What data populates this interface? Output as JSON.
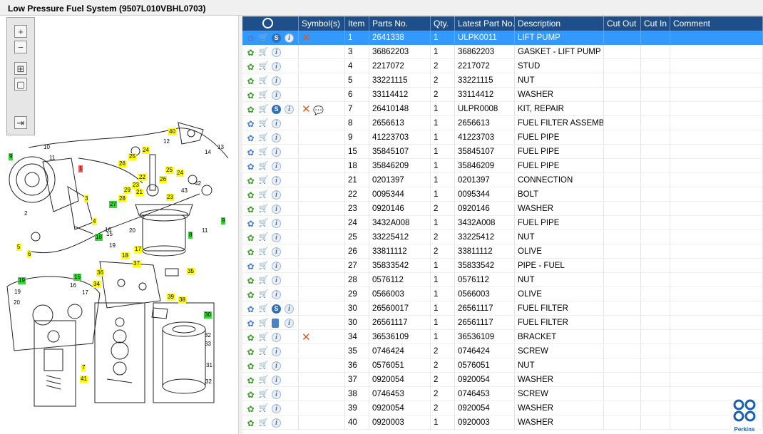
{
  "window": {
    "title": "Low Pressure Fuel System (9507L010VBHL0703)"
  },
  "diagram": {
    "toolbar": [
      {
        "name": "zoom-in-button",
        "glyph": "+"
      },
      {
        "name": "zoom-out-button",
        "glyph": "−"
      },
      {
        "name": "fit-all-button",
        "glyph": "⊞"
      },
      {
        "name": "zoom-window-button",
        "glyph": "▢"
      },
      {
        "name": "export-button",
        "glyph": "⇥"
      }
    ],
    "callouts": [
      {
        "t": "40",
        "c": "y"
      },
      {
        "t": "12",
        "c": "p"
      },
      {
        "t": "14",
        "c": "p"
      },
      {
        "t": "13",
        "c": "p"
      },
      {
        "t": "10",
        "c": "p"
      },
      {
        "t": "11",
        "c": "p"
      },
      {
        "t": "9",
        "c": "g"
      },
      {
        "t": "1",
        "c": "r"
      },
      {
        "t": "25",
        "c": "y"
      },
      {
        "t": "24",
        "c": "y"
      },
      {
        "t": "26",
        "c": "y"
      },
      {
        "t": "22",
        "c": "y"
      },
      {
        "t": "25",
        "c": "y"
      },
      {
        "t": "24",
        "c": "y"
      },
      {
        "t": "23",
        "c": "y"
      },
      {
        "t": "26",
        "c": "y"
      },
      {
        "t": "29",
        "c": "y"
      },
      {
        "t": "21",
        "c": "y"
      },
      {
        "t": "43",
        "c": "p"
      },
      {
        "t": "42",
        "c": "p"
      },
      {
        "t": "28",
        "c": "y"
      },
      {
        "t": "27",
        "c": "g"
      },
      {
        "t": "23",
        "c": "y"
      },
      {
        "t": "3",
        "c": "y"
      },
      {
        "t": "2",
        "c": "p"
      },
      {
        "t": "4",
        "c": "y"
      },
      {
        "t": "16",
        "c": "p"
      },
      {
        "t": "15",
        "c": "p"
      },
      {
        "t": "20",
        "c": "p"
      },
      {
        "t": "18",
        "c": "g"
      },
      {
        "t": "17",
        "c": "y"
      },
      {
        "t": "11",
        "c": "p"
      },
      {
        "t": "9",
        "c": "g"
      },
      {
        "t": "8",
        "c": "g"
      },
      {
        "t": "5",
        "c": "y"
      },
      {
        "t": "6",
        "c": "y"
      },
      {
        "t": "19",
        "c": "p"
      },
      {
        "t": "18",
        "c": "y"
      },
      {
        "t": "37",
        "c": "y"
      },
      {
        "t": "35",
        "c": "y"
      },
      {
        "t": "15",
        "c": "g"
      },
      {
        "t": "36",
        "c": "y"
      },
      {
        "t": "34",
        "c": "y"
      },
      {
        "t": "19",
        "c": "g"
      },
      {
        "t": "19",
        "c": "p"
      },
      {
        "t": "20",
        "c": "p"
      },
      {
        "t": "16",
        "c": "p"
      },
      {
        "t": "17",
        "c": "p"
      },
      {
        "t": "39",
        "c": "y"
      },
      {
        "t": "38",
        "c": "y"
      },
      {
        "t": "30",
        "c": "g"
      },
      {
        "t": "32",
        "c": "p"
      },
      {
        "t": "33",
        "c": "p"
      },
      {
        "t": "7",
        "c": "y"
      },
      {
        "t": "41",
        "c": "y"
      },
      {
        "t": "31",
        "c": "p"
      },
      {
        "t": "32",
        "c": "p"
      }
    ]
  },
  "grid": {
    "columns": [
      "",
      "Symbol(s)",
      "Item",
      "Parts No.",
      "Qty.",
      "Latest Part No.",
      "Description",
      "Cut Out",
      "Cut In",
      "Comment"
    ],
    "rows": [
      {
        "icons": [
          "gear-blue",
          "cart",
          "s",
          "i"
        ],
        "sym": "x",
        "item": "1",
        "part": "2641338",
        "qty": "1",
        "latest": "ULPK0011",
        "desc": "LIFT PUMP",
        "selected": true
      },
      {
        "icons": [
          "gear",
          "cart",
          "i"
        ],
        "sym": "",
        "item": "3",
        "part": "36862203",
        "qty": "1",
        "latest": "36862203",
        "desc": "GASKET - LIFT PUMP"
      },
      {
        "icons": [
          "gear",
          "cart",
          "i"
        ],
        "sym": "",
        "item": "4",
        "part": "2217072",
        "qty": "2",
        "latest": "2217072",
        "desc": "STUD"
      },
      {
        "icons": [
          "gear",
          "cart",
          "i"
        ],
        "sym": "",
        "item": "5",
        "part": "33221115",
        "qty": "2",
        "latest": "33221115",
        "desc": "NUT"
      },
      {
        "icons": [
          "gear",
          "cart",
          "i"
        ],
        "sym": "",
        "item": "6",
        "part": "33114412",
        "qty": "2",
        "latest": "33114412",
        "desc": "WASHER"
      },
      {
        "icons": [
          "gear",
          "cart",
          "s",
          "i"
        ],
        "sym": "x-tip",
        "item": "7",
        "part": "26410148",
        "qty": "1",
        "latest": "ULPR0008",
        "desc": "KIT, REPAIR"
      },
      {
        "icons": [
          "gear-blue",
          "cart",
          "i"
        ],
        "sym": "",
        "item": "8",
        "part": "2656613",
        "qty": "1",
        "latest": "2656613",
        "desc": "FUEL FILTER ASSEMBLY"
      },
      {
        "icons": [
          "gear-blue",
          "cart",
          "i"
        ],
        "sym": "",
        "item": "9",
        "part": "41223703",
        "qty": "1",
        "latest": "41223703",
        "desc": "FUEL PIPE"
      },
      {
        "icons": [
          "gear-blue",
          "cart",
          "i"
        ],
        "sym": "",
        "item": "15",
        "part": "35845107",
        "qty": "1",
        "latest": "35845107",
        "desc": "FUEL PIPE"
      },
      {
        "icons": [
          "gear-blue",
          "cart",
          "i"
        ],
        "sym": "",
        "item": "18",
        "part": "35846209",
        "qty": "1",
        "latest": "35846209",
        "desc": "FUEL PIPE"
      },
      {
        "icons": [
          "gear",
          "cart",
          "i"
        ],
        "sym": "",
        "item": "21",
        "part": "0201397",
        "qty": "1",
        "latest": "0201397",
        "desc": "CONNECTION"
      },
      {
        "icons": [
          "gear",
          "cart",
          "i"
        ],
        "sym": "",
        "item": "22",
        "part": "0095344",
        "qty": "1",
        "latest": "0095344",
        "desc": "BOLT"
      },
      {
        "icons": [
          "gear",
          "cart",
          "i"
        ],
        "sym": "",
        "item": "23",
        "part": "0920146",
        "qty": "2",
        "latest": "0920146",
        "desc": "WASHER"
      },
      {
        "icons": [
          "gear-blue",
          "cart",
          "i"
        ],
        "sym": "",
        "item": "24",
        "part": "3432A008",
        "qty": "1",
        "latest": "3432A008",
        "desc": "FUEL PIPE"
      },
      {
        "icons": [
          "gear",
          "cart",
          "i"
        ],
        "sym": "",
        "item": "25",
        "part": "33225412",
        "qty": "2",
        "latest": "33225412",
        "desc": "NUT"
      },
      {
        "icons": [
          "gear",
          "cart",
          "i"
        ],
        "sym": "",
        "item": "26",
        "part": "33811112",
        "qty": "2",
        "latest": "33811112",
        "desc": "OLIVE"
      },
      {
        "icons": [
          "gear-blue",
          "cart",
          "i"
        ],
        "sym": "",
        "item": "27",
        "part": "35833542",
        "qty": "1",
        "latest": "35833542",
        "desc": "PIPE - FUEL"
      },
      {
        "icons": [
          "gear",
          "cart",
          "i"
        ],
        "sym": "",
        "item": "28",
        "part": "0576112",
        "qty": "1",
        "latest": "0576112",
        "desc": "NUT"
      },
      {
        "icons": [
          "gear",
          "cart",
          "i"
        ],
        "sym": "",
        "item": "29",
        "part": "0566003",
        "qty": "1",
        "latest": "0566003",
        "desc": "OLIVE"
      },
      {
        "icons": [
          "gear-blue",
          "cart",
          "s",
          "i"
        ],
        "sym": "",
        "item": "30",
        "part": "26560017",
        "qty": "1",
        "latest": "26561117",
        "desc": "FUEL FILTER"
      },
      {
        "icons": [
          "gear-blue",
          "cart",
          "book",
          "i"
        ],
        "sym": "",
        "item": "30",
        "part": "26561117",
        "qty": "1",
        "latest": "26561117",
        "desc": "FUEL FILTER"
      },
      {
        "icons": [
          "gear",
          "cart",
          "i"
        ],
        "sym": "x",
        "item": "34",
        "part": "36536109",
        "qty": "1",
        "latest": "36536109",
        "desc": "BRACKET"
      },
      {
        "icons": [
          "gear",
          "cart",
          "i"
        ],
        "sym": "",
        "item": "35",
        "part": "0746424",
        "qty": "2",
        "latest": "0746424",
        "desc": "SCREW"
      },
      {
        "icons": [
          "gear",
          "cart",
          "i"
        ],
        "sym": "",
        "item": "36",
        "part": "0576051",
        "qty": "2",
        "latest": "0576051",
        "desc": "NUT"
      },
      {
        "icons": [
          "gear",
          "cart",
          "i"
        ],
        "sym": "",
        "item": "37",
        "part": "0920054",
        "qty": "2",
        "latest": "0920054",
        "desc": "WASHER"
      },
      {
        "icons": [
          "gear",
          "cart",
          "i"
        ],
        "sym": "",
        "item": "38",
        "part": "0746453",
        "qty": "2",
        "latest": "0746453",
        "desc": "SCREW"
      },
      {
        "icons": [
          "gear",
          "cart",
          "i"
        ],
        "sym": "",
        "item": "39",
        "part": "0920054",
        "qty": "2",
        "latest": "0920054",
        "desc": "WASHER"
      },
      {
        "icons": [
          "gear",
          "cart",
          "i"
        ],
        "sym": "",
        "item": "40",
        "part": "0920003",
        "qty": "1",
        "latest": "0920003",
        "desc": "WASHER"
      }
    ]
  },
  "brand": {
    "name": "Perkins",
    "color": "#1a5fb4"
  },
  "colors": {
    "header": "#1e4f8a",
    "selected_row": "#3399ff"
  }
}
